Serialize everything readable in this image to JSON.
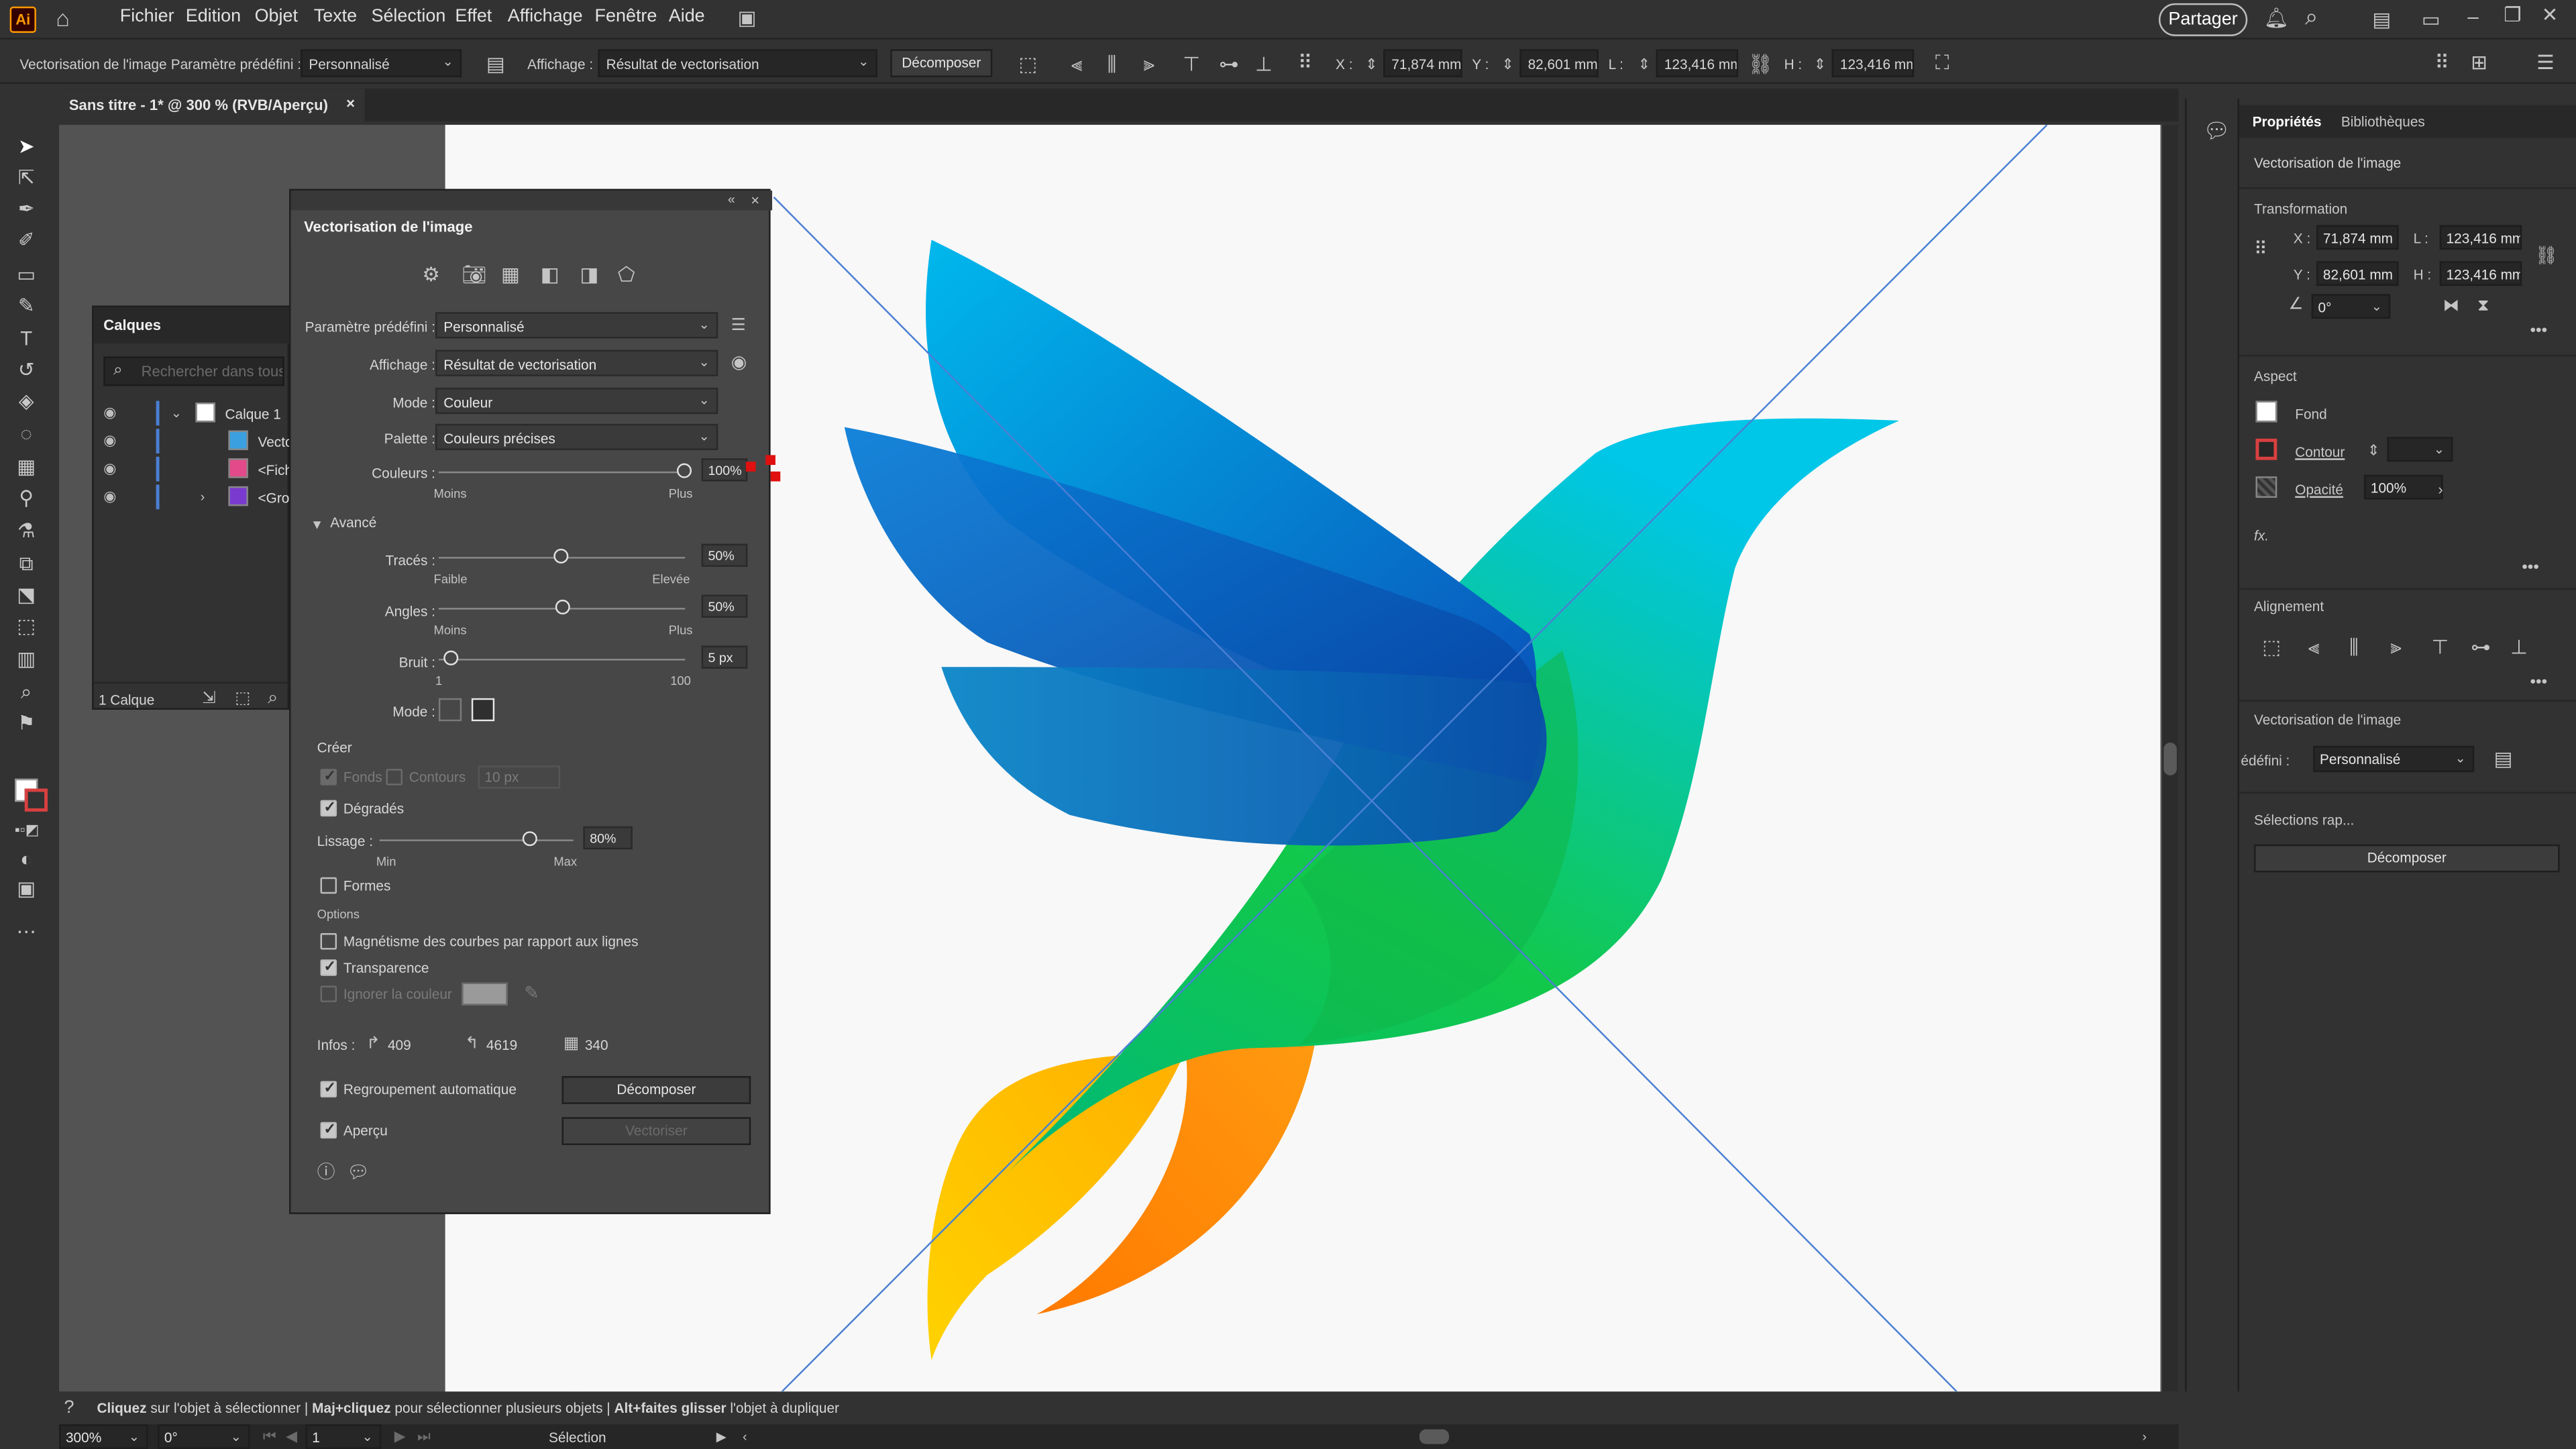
{
  "app": {
    "logo": "Ai"
  },
  "menu": [
    "Fichier",
    "Edition",
    "Objet",
    "Texte",
    "Sélection",
    "Effet",
    "Affichage",
    "Fenêtre",
    "Aide"
  ],
  "share_label": "Partager",
  "control": {
    "context": "Vectorisation de l'image",
    "preset_label": "Paramètre prédéfini :",
    "preset_value": "Personnalisé",
    "view_label": "Affichage :",
    "view_value": "Résultat de vectorisation",
    "expand_label": "Décomposer",
    "x_label": "X :",
    "x_value": "71,874 mm",
    "y_label": "Y :",
    "y_value": "82,601 mm",
    "w_label": "L :",
    "w_value": "123,416 mm",
    "h_label": "H :",
    "h_value": "123,416 mm"
  },
  "document_tab": {
    "title": "Sans titre - 1* @ 300 % (RVB/Aperçu)",
    "close": "×"
  },
  "layers": {
    "title": "Calques",
    "search_placeholder": "Rechercher dans tous",
    "rows": [
      {
        "name": "Calque 1"
      },
      {
        "name": "Vecto"
      },
      {
        "name": "<Fich"
      },
      {
        "name": "<Gro"
      }
    ],
    "count": "1 Calque"
  },
  "dialog": {
    "title": "Vectorisation de l'image",
    "preset_label": "Paramètre prédéfini :",
    "preset_value": "Personnalisé",
    "view_label": "Affichage :",
    "view_value": "Résultat de vectorisation",
    "mode_label": "Mode :",
    "mode_value": "Couleur",
    "palette_label": "Palette :",
    "palette_value": "Couleurs précises",
    "colors_label": "Couleurs :",
    "colors_value": "100%",
    "colors_level": 1.0,
    "less": "Moins",
    "more": "Plus",
    "advanced_label": "Avancé",
    "paths_label": "Tracés :",
    "paths_value": "50%",
    "paths_level": 0.5,
    "low": "Faible",
    "high": "Elevée",
    "corners_label": "Angles :",
    "corners_value": "50%",
    "corners_level": 0.5,
    "noise_label": "Bruit :",
    "noise_value": "5 px",
    "noise_level": 0.04,
    "noise_min": "1",
    "noise_max": "100",
    "method_label": "Mode :",
    "create_label": "Créer",
    "fills_label": "Fonds",
    "strokes_label": "Contours",
    "stroke_value": "10 px",
    "gradients_label": "Dégradés",
    "smoothing_label": "Lissage :",
    "smoothing_value": "80%",
    "smoothing_level": 0.8,
    "min": "Min",
    "max": "Max",
    "shapes_label": "Formes",
    "options_label": "Options",
    "snap_label": "Magnétisme des courbes par rapport aux lignes",
    "transparency_label": "Transparence",
    "ignore_color_label": "Ignorer la couleur",
    "info_label": "Infos :",
    "info_paths": "409",
    "info_anchors": "4619",
    "info_colors": "340",
    "autogroup_label": "Regroupement automatique",
    "expand_button": "Décomposer",
    "preview_label": "Aperçu",
    "trace_button": "Vectoriser"
  },
  "properties": {
    "tab_properties": "Propriétés",
    "tab_libraries": "Bibliothèques",
    "context": "Vectorisation de l'image",
    "transform_label": "Transformation",
    "x_label": "X :",
    "x_value": "71,874 mm",
    "y_label": "Y :",
    "y_value": "82,601 mm",
    "w_label": "L :",
    "w_value": "123,416 mm",
    "h_label": "H :",
    "h_value": "123,416 mm",
    "angle_value": "0°",
    "appearance_label": "Aspect",
    "fill_label": "Fond",
    "stroke_label": "Contour",
    "opacity_label": "Opacité",
    "opacity_value": "100%",
    "fx_label": "fx.",
    "align_label": "Alignement",
    "trace_label": "Vectorisation de l'image",
    "preset_label": "édéfini :",
    "preset_value": "Personnalisé",
    "quick_actions": "Sélections rap...",
    "expand_button": "Décomposer"
  },
  "hint": {
    "a_bold": "Cliquez",
    "a": " sur l'objet à sélectionner  |  ",
    "b_bold": "Maj+cliquez",
    "b": " pour sélectionner plusieurs objets  |  ",
    "c_bold": "Alt+faites glisser",
    "c": " l'objet à dupliquer"
  },
  "status": {
    "zoom": "300%",
    "rotation": "0°",
    "artboard": "1",
    "tool": "Sélection"
  },
  "colors": {
    "accent": "#4a7fd4",
    "bird_blue": "#0a6fd0",
    "bird_green": "#12c84a",
    "bird_yellow": "#ffc400",
    "bird_orange": "#ff8a00"
  }
}
